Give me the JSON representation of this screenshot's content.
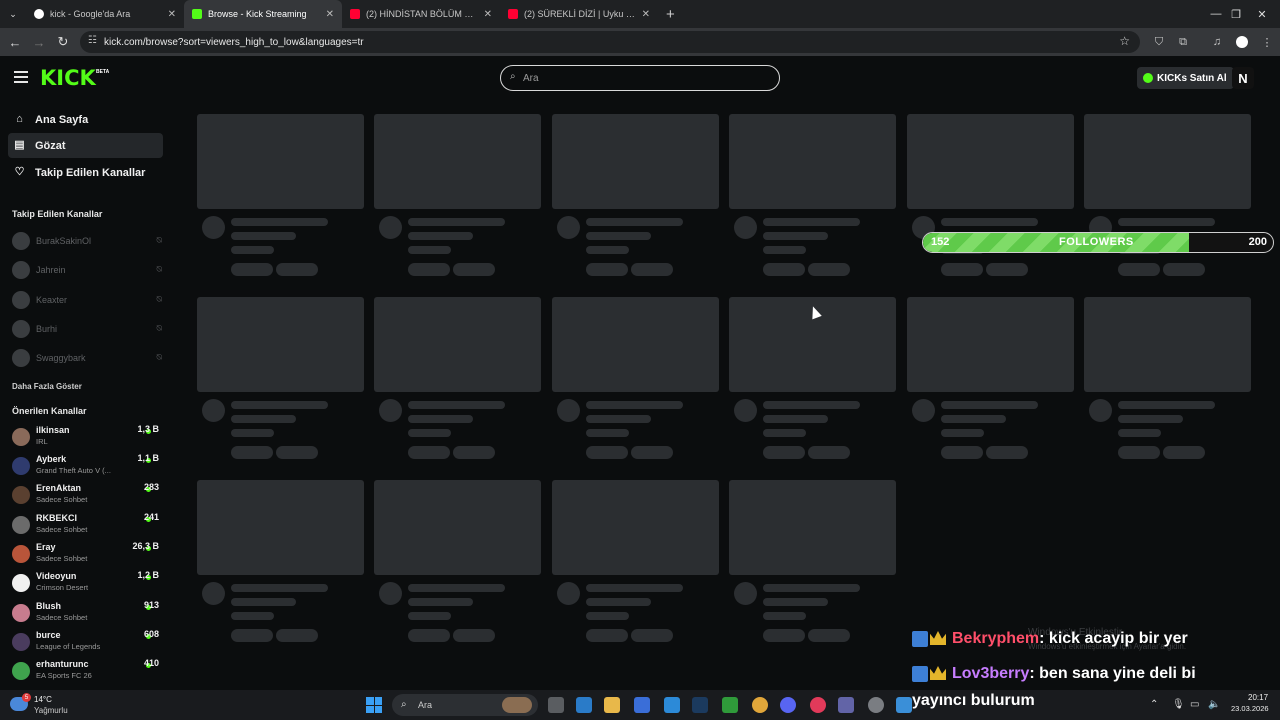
{
  "browser": {
    "tabs": [
      {
        "label": "kick - Google'da Ara",
        "favicon_color": "#ffffff"
      },
      {
        "label": "Browse - Kick Streaming",
        "favicon_color": "#53fc18"
      },
      {
        "label": "(2) HİNDİSTAN BÖLÜM 2: VARA",
        "favicon_color": "#ff0033"
      },
      {
        "label": "(2) SÜREKLİ DİZİ | Uyku Döngüs",
        "favicon_color": "#ff0033"
      }
    ],
    "url": "kick.com/browse?sort=viewers_high_to_low&languages=tr"
  },
  "header": {
    "logo": "KICK",
    "logo_badge": "BETA",
    "search_placeholder": "Ara",
    "kicks_button": "KICKs Satın Al",
    "avatar_letter": "N"
  },
  "sidebar": {
    "nav": [
      {
        "label": "Ana Sayfa",
        "icon": "home-icon"
      },
      {
        "label": "Gözat",
        "icon": "browse-icon"
      },
      {
        "label": "Takip Edilen Kanallar",
        "icon": "heart-icon"
      }
    ],
    "followed_title": "Takip Edilen Kanallar",
    "followed": [
      {
        "name": "BurakSakinOl"
      },
      {
        "name": "Jahrein"
      },
      {
        "name": "Keaxter"
      },
      {
        "name": "Burhi"
      },
      {
        "name": "Swaggybark"
      }
    ],
    "show_more": "Daha Fazla Göster",
    "recommended_title": "Önerilen Kanallar",
    "recommended": [
      {
        "name": "ilkinsan",
        "category": "IRL",
        "viewers": "1,3 B",
        "color": "#8a6a5a"
      },
      {
        "name": "Ayberk",
        "category": "Grand Theft Auto V (...",
        "viewers": "1,1 B",
        "color": "#2f3b6e"
      },
      {
        "name": "ErenAktan",
        "category": "Sadece Sohbet",
        "viewers": "283",
        "color": "#5a4030"
      },
      {
        "name": "RKBEKCI",
        "category": "Sadece Sohbet",
        "viewers": "241",
        "color": "#6b6b6b"
      },
      {
        "name": "Eray",
        "category": "Sadece Sohbet",
        "viewers": "26,3 B",
        "color": "#b9553a"
      },
      {
        "name": "Videoyun",
        "category": "Crimson Desert",
        "viewers": "1,2 B",
        "color": "#f0f0f0"
      },
      {
        "name": "Blush",
        "category": "Sadece Sohbet",
        "viewers": "913",
        "color": "#c87c8e"
      },
      {
        "name": "burce",
        "category": "League of Legends",
        "viewers": "608",
        "color": "#4a3c5e"
      },
      {
        "name": "erhanturunc",
        "category": "EA Sports FC 26",
        "viewers": "410",
        "color": "#3fa34d"
      }
    ]
  },
  "followers_goal": {
    "current": "152",
    "label": "FOLLOWERS",
    "goal": "200",
    "progress": 0.76
  },
  "watermark": {
    "line1": "Windows'u Etkinleştir",
    "line2": "Windows'u etkinleştirmek için Ayarlar'a gidin."
  },
  "chat": [
    {
      "user": "Bekryphem",
      "message": ": kick acayip bir yer"
    },
    {
      "user": "Lov3berry",
      "message": ": ben sana yine deli bi"
    }
  ],
  "chat_overflow": "yayıncı bulurum",
  "taskbar": {
    "weather_temp": "14°C",
    "weather_desc": "Yağmurlu",
    "weather_badge": "5",
    "search_placeholder": "Ara",
    "time": "20:17",
    "date": "23.03.2026"
  }
}
